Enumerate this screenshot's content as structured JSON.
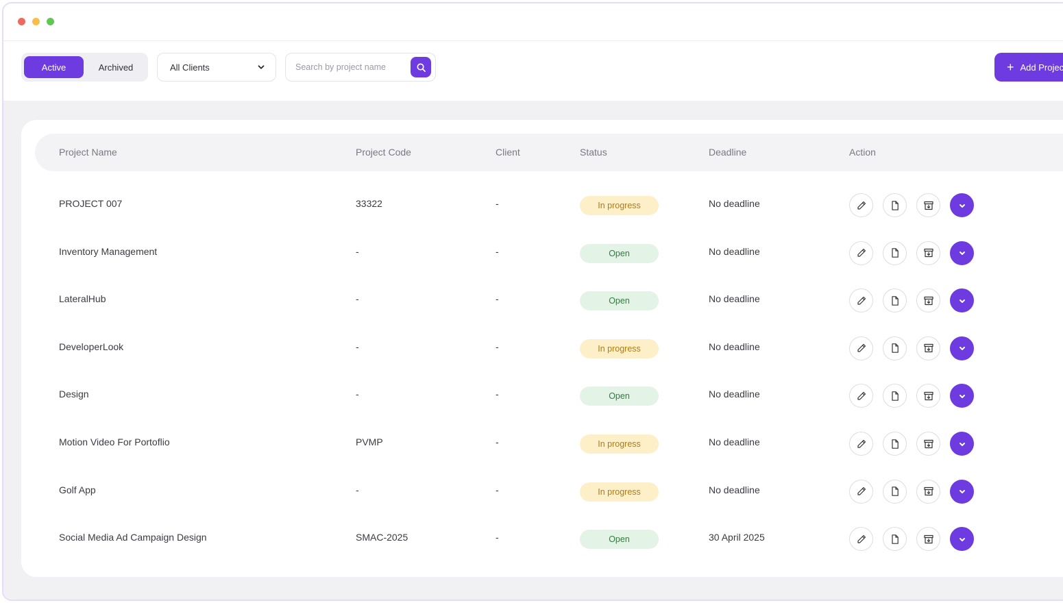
{
  "window": {
    "controls": [
      "close",
      "minimize",
      "maximize"
    ]
  },
  "toolbar": {
    "tabs": [
      {
        "label": "Active",
        "selected": true
      },
      {
        "label": "Archived",
        "selected": false
      }
    ],
    "client_filter": {
      "value": "All Clients",
      "icon": "chevron-down-icon"
    },
    "search": {
      "placeholder": "Search by project name",
      "value": "",
      "icon": "search-icon"
    },
    "add_button": {
      "label": "Add Project",
      "icon": "plus-icon"
    }
  },
  "table": {
    "headers": [
      "Project Name",
      "Project Code",
      "Client",
      "Status",
      "Deadline",
      "Action"
    ],
    "rows": [
      {
        "name": "PROJECT 007",
        "code": "33322",
        "client": "-",
        "status": "In progress",
        "deadline": "No deadline"
      },
      {
        "name": "Inventory Management",
        "code": "-",
        "client": "-",
        "status": "Open",
        "deadline": "No deadline"
      },
      {
        "name": "LateralHub",
        "code": "-",
        "client": "-",
        "status": "Open",
        "deadline": "No deadline"
      },
      {
        "name": "DeveloperLook",
        "code": "-",
        "client": "-",
        "status": "In progress",
        "deadline": "No deadline"
      },
      {
        "name": "Design",
        "code": "-",
        "client": "-",
        "status": "Open",
        "deadline": "No deadline"
      },
      {
        "name": "Motion Video For Portoflio",
        "code": "PVMP",
        "client": "-",
        "status": "In progress",
        "deadline": "No deadline"
      },
      {
        "name": "Golf App",
        "code": "-",
        "client": "-",
        "status": "In progress",
        "deadline": "No deadline"
      },
      {
        "name": "Social Media Ad Campaign Design",
        "code": "SMAC-2025",
        "client": "-",
        "status": "Open",
        "deadline": "30 April 2025"
      }
    ],
    "row_actions": [
      "edit-icon",
      "document-icon",
      "archive-icon",
      "chevron-down-icon"
    ]
  },
  "colors": {
    "accent": "#6d3be0",
    "in_progress_bg": "#fdf0c9",
    "in_progress_text": "#b07a14",
    "open_bg": "#e3f3e6",
    "open_text": "#2e7d3d"
  }
}
